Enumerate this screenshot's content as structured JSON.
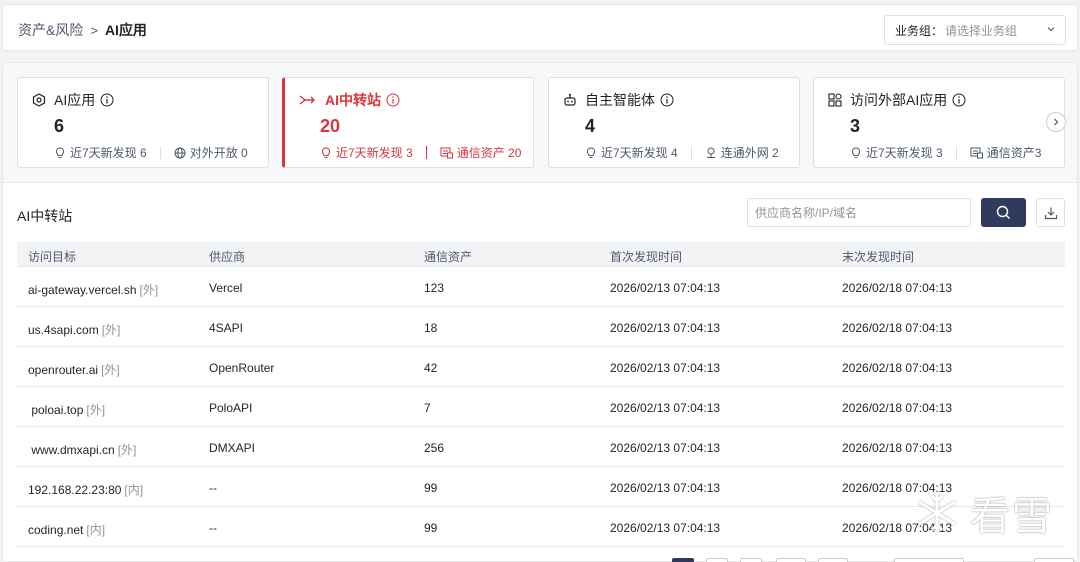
{
  "breadcrumb": {
    "parent": "资产&风险",
    "separator": ">",
    "current": "AI应用"
  },
  "business_group": {
    "label": "业务组：",
    "placeholder": "请选择业务组"
  },
  "cards": [
    {
      "title": "AI应用",
      "count": "6",
      "stat1": "近7天新发现 6",
      "stat2": "对外开放 0"
    },
    {
      "title": "AI中转站",
      "count": "20",
      "stat1": "近7天新发现 3",
      "stat2": "通信资产 20"
    },
    {
      "title": "自主智能体",
      "count": "4",
      "stat1": "近7天新发现 4",
      "stat2": "连通外网 2"
    },
    {
      "title": "访问外部AI应用",
      "count": "3",
      "stat1": "近7天新发现 3",
      "stat2": "通信资产3"
    }
  ],
  "section": {
    "title": "AI中转站",
    "search_placeholder": "供应商名称/IP/域名"
  },
  "table": {
    "headers": [
      "访问目标",
      "供应商",
      "通信资产",
      "首次发现时间",
      "末次发现时间"
    ],
    "rows": [
      {
        "target": "ai-gateway.vercel.sh",
        "tag": "[外]",
        "vendor": "Vercel",
        "assets": "123",
        "first": "2026/02/13 07:04:13",
        "last": "2026/02/18 07:04:13"
      },
      {
        "target": "us.4sapi.com",
        "tag": "[外]",
        "vendor": "4SAPI",
        "assets": "18",
        "first": "2026/02/13 07:04:13",
        "last": "2026/02/18 07:04:13"
      },
      {
        "target": "openrouter.ai",
        "tag": "[外]",
        "vendor": "OpenRouter",
        "assets": "42",
        "first": "2026/02/13 07:04:13",
        "last": "2026/02/18 07:04:13"
      },
      {
        "target": " poloai.top",
        "tag": "[外]",
        "vendor": "PoloAPI",
        "assets": "7",
        "first": "2026/02/13 07:04:13",
        "last": "2026/02/18 07:04:13"
      },
      {
        "target": " www.dmxapi.cn",
        "tag": "[外]",
        "vendor": "DMXAPI",
        "assets": "256",
        "first": "2026/02/13 07:04:13",
        "last": "2026/02/18 07:04:13"
      },
      {
        "target": "192.168.22.23:80",
        "tag": "[内]",
        "vendor": "--",
        "assets": "99",
        "first": "2026/02/13 07:04:13",
        "last": "2026/02/18 07:04:13"
      },
      {
        "target": "coding.net",
        "tag": "[内]",
        "vendor": "--",
        "assets": "99",
        "first": "2026/02/13 07:04:13",
        "last": "2026/02/18 07:04:13"
      }
    ]
  },
  "watermark": {
    "text": "看雪"
  },
  "colors": {
    "accent": "#d9363e",
    "primary_button": "#2f3b5c"
  }
}
